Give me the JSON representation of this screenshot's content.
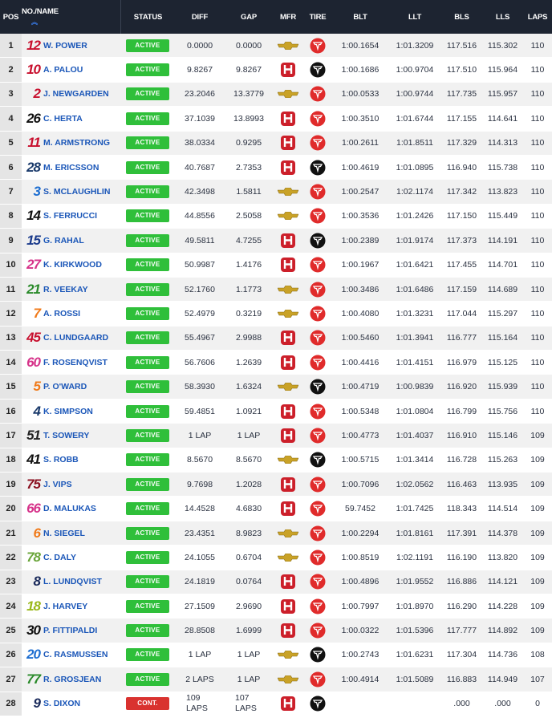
{
  "headers": {
    "pos": "POS",
    "name": "NO./NAME",
    "status": "STATUS",
    "diff": "DIFF",
    "gap": "GAP",
    "mfr": "MFR",
    "tire": "TIRE",
    "blt": "BLT",
    "llt": "LLT",
    "bls": "BLS",
    "lls": "LLS",
    "laps": "LAPS"
  },
  "colors": {
    "header_bg": "#1d2431",
    "active": "#2fbf3a",
    "cont": "#d9322f",
    "name": "#1a56b8",
    "tire_red": "#e02b2b",
    "tire_black": "#111111",
    "honda_red": "#cc1f2a",
    "chevy_gold": "#c9a227"
  },
  "rows": [
    {
      "pos": "1",
      "num": "12",
      "num_color": "#c8102e",
      "name": "W. POWER",
      "status": "ACTIVE",
      "diff": "0.0000",
      "gap": "0.0000",
      "mfr": "chevrolet",
      "tire": "red",
      "blt": "1:00.1654",
      "llt": "1:01.3209",
      "bls": "117.516",
      "lls": "115.302",
      "laps": "110"
    },
    {
      "pos": "2",
      "num": "10",
      "num_color": "#c8102e",
      "name": "A. PALOU",
      "status": "ACTIVE",
      "diff": "9.8267",
      "gap": "9.8267",
      "mfr": "honda",
      "tire": "black",
      "blt": "1:00.1686",
      "llt": "1:00.9704",
      "bls": "117.510",
      "lls": "115.964",
      "laps": "110"
    },
    {
      "pos": "3",
      "num": "2",
      "num_color": "#c8102e",
      "name": "J. NEWGARDEN",
      "status": "ACTIVE",
      "diff": "23.2046",
      "gap": "13.3779",
      "mfr": "chevrolet",
      "tire": "red",
      "blt": "1:00.0533",
      "llt": "1:00.9744",
      "bls": "117.735",
      "lls": "115.957",
      "laps": "110"
    },
    {
      "pos": "4",
      "num": "26",
      "num_color": "#111111",
      "name": "C. HERTA",
      "status": "ACTIVE",
      "diff": "37.1039",
      "gap": "13.8993",
      "mfr": "honda",
      "tire": "red",
      "blt": "1:00.3510",
      "llt": "1:01.6744",
      "bls": "117.155",
      "lls": "114.641",
      "laps": "110"
    },
    {
      "pos": "5",
      "num": "11",
      "num_color": "#c8102e",
      "name": "M. ARMSTRONG",
      "status": "ACTIVE",
      "diff": "38.0334",
      "gap": "0.9295",
      "mfr": "honda",
      "tire": "red",
      "blt": "1:00.2611",
      "llt": "1:01.8511",
      "bls": "117.329",
      "lls": "114.313",
      "laps": "110"
    },
    {
      "pos": "6",
      "num": "28",
      "num_color": "#1a3a6b",
      "name": "M. ERICSSON",
      "status": "ACTIVE",
      "diff": "40.7687",
      "gap": "2.7353",
      "mfr": "honda",
      "tire": "black",
      "blt": "1:00.4619",
      "llt": "1:01.0895",
      "bls": "116.940",
      "lls": "115.738",
      "laps": "110"
    },
    {
      "pos": "7",
      "num": "3",
      "num_color": "#1f6fd1",
      "name": "S. MCLAUGHLIN",
      "status": "ACTIVE",
      "diff": "42.3498",
      "gap": "1.5811",
      "mfr": "chevrolet",
      "tire": "red",
      "blt": "1:00.2547",
      "llt": "1:02.1174",
      "bls": "117.342",
      "lls": "113.823",
      "laps": "110"
    },
    {
      "pos": "8",
      "num": "14",
      "num_color": "#111111",
      "name": "S. FERRUCCI",
      "status": "ACTIVE",
      "diff": "44.8556",
      "gap": "2.5058",
      "mfr": "chevrolet",
      "tire": "red",
      "blt": "1:00.3536",
      "llt": "1:01.2426",
      "bls": "117.150",
      "lls": "115.449",
      "laps": "110"
    },
    {
      "pos": "9",
      "num": "15",
      "num_color": "#1a3a8b",
      "name": "G. RAHAL",
      "status": "ACTIVE",
      "diff": "49.5811",
      "gap": "4.7255",
      "mfr": "honda",
      "tire": "black",
      "blt": "1:00.2389",
      "llt": "1:01.9174",
      "bls": "117.373",
      "lls": "114.191",
      "laps": "110"
    },
    {
      "pos": "10",
      "num": "27",
      "num_color": "#d6338a",
      "name": "K. KIRKWOOD",
      "status": "ACTIVE",
      "diff": "50.9987",
      "gap": "1.4176",
      "mfr": "honda",
      "tire": "red",
      "blt": "1:00.1967",
      "llt": "1:01.6421",
      "bls": "117.455",
      "lls": "114.701",
      "laps": "110"
    },
    {
      "pos": "11",
      "num": "21",
      "num_color": "#2a8a2a",
      "name": "R. VEEKAY",
      "status": "ACTIVE",
      "diff": "52.1760",
      "gap": "1.1773",
      "mfr": "chevrolet",
      "tire": "red",
      "blt": "1:00.3486",
      "llt": "1:01.6486",
      "bls": "117.159",
      "lls": "114.689",
      "laps": "110"
    },
    {
      "pos": "12",
      "num": "7",
      "num_color": "#f07a1a",
      "name": "A. ROSSI",
      "status": "ACTIVE",
      "diff": "52.4979",
      "gap": "0.3219",
      "mfr": "chevrolet",
      "tire": "red",
      "blt": "1:00.4080",
      "llt": "1:01.3231",
      "bls": "117.044",
      "lls": "115.297",
      "laps": "110"
    },
    {
      "pos": "13",
      "num": "45",
      "num_color": "#c8102e",
      "name": "C. LUNDGAARD",
      "status": "ACTIVE",
      "diff": "55.4967",
      "gap": "2.9988",
      "mfr": "honda",
      "tire": "red",
      "blt": "1:00.5460",
      "llt": "1:01.3941",
      "bls": "116.777",
      "lls": "115.164",
      "laps": "110"
    },
    {
      "pos": "14",
      "num": "60",
      "num_color": "#d6338a",
      "name": "F. ROSENQVIST",
      "status": "ACTIVE",
      "diff": "56.7606",
      "gap": "1.2639",
      "mfr": "honda",
      "tire": "red",
      "blt": "1:00.4416",
      "llt": "1:01.4151",
      "bls": "116.979",
      "lls": "115.125",
      "laps": "110"
    },
    {
      "pos": "15",
      "num": "5",
      "num_color": "#f07a1a",
      "name": "P. O'WARD",
      "status": "ACTIVE",
      "diff": "58.3930",
      "gap": "1.6324",
      "mfr": "chevrolet",
      "tire": "black",
      "blt": "1:00.4719",
      "llt": "1:00.9839",
      "bls": "116.920",
      "lls": "115.939",
      "laps": "110"
    },
    {
      "pos": "16",
      "num": "4",
      "num_color": "#1a3a6b",
      "name": "K. SIMPSON",
      "status": "ACTIVE",
      "diff": "59.4851",
      "gap": "1.0921",
      "mfr": "honda",
      "tire": "red",
      "blt": "1:00.5348",
      "llt": "1:01.0804",
      "bls": "116.799",
      "lls": "115.756",
      "laps": "110"
    },
    {
      "pos": "17",
      "num": "51",
      "num_color": "#222222",
      "name": "T. SOWERY",
      "status": "ACTIVE",
      "diff": "1 LAP",
      "gap": "1 LAP",
      "mfr": "honda",
      "tire": "red",
      "blt": "1:00.4773",
      "llt": "1:01.4037",
      "bls": "116.910",
      "lls": "115.146",
      "laps": "109"
    },
    {
      "pos": "18",
      "num": "41",
      "num_color": "#111111",
      "name": "S. ROBB",
      "status": "ACTIVE",
      "diff": "8.5670",
      "gap": "8.5670",
      "mfr": "chevrolet",
      "tire": "black",
      "blt": "1:00.5715",
      "llt": "1:01.3414",
      "bls": "116.728",
      "lls": "115.263",
      "laps": "109"
    },
    {
      "pos": "19",
      "num": "75",
      "num_color": "#8a1020",
      "name": "J. VIPS",
      "status": "ACTIVE",
      "diff": "9.7698",
      "gap": "1.2028",
      "mfr": "honda",
      "tire": "red",
      "blt": "1:00.7096",
      "llt": "1:02.0562",
      "bls": "116.463",
      "lls": "113.935",
      "laps": "109"
    },
    {
      "pos": "20",
      "num": "66",
      "num_color": "#d6338a",
      "name": "D. MALUKAS",
      "status": "ACTIVE",
      "diff": "14.4528",
      "gap": "4.6830",
      "mfr": "honda",
      "tire": "red",
      "blt": "59.7452",
      "llt": "1:01.7425",
      "bls": "118.343",
      "lls": "114.514",
      "laps": "109"
    },
    {
      "pos": "21",
      "num": "6",
      "num_color": "#f07a1a",
      "name": "N. SIEGEL",
      "status": "ACTIVE",
      "diff": "23.4351",
      "gap": "8.9823",
      "mfr": "chevrolet",
      "tire": "red",
      "blt": "1:00.2294",
      "llt": "1:01.8161",
      "bls": "117.391",
      "lls": "114.378",
      "laps": "109"
    },
    {
      "pos": "22",
      "num": "78",
      "num_color": "#6aa53a",
      "name": "C. DALY",
      "status": "ACTIVE",
      "diff": "24.1055",
      "gap": "0.6704",
      "mfr": "chevrolet",
      "tire": "red",
      "blt": "1:00.8519",
      "llt": "1:02.1191",
      "bls": "116.190",
      "lls": "113.820",
      "laps": "109"
    },
    {
      "pos": "23",
      "num": "8",
      "num_color": "#1a2a5b",
      "name": "L. LUNDQVIST",
      "status": "ACTIVE",
      "diff": "24.1819",
      "gap": "0.0764",
      "mfr": "honda",
      "tire": "red",
      "blt": "1:00.4896",
      "llt": "1:01.9552",
      "bls": "116.886",
      "lls": "114.121",
      "laps": "109"
    },
    {
      "pos": "24",
      "num": "18",
      "num_color": "#9ab81a",
      "name": "J. HARVEY",
      "status": "ACTIVE",
      "diff": "27.1509",
      "gap": "2.9690",
      "mfr": "honda",
      "tire": "red",
      "blt": "1:00.7997",
      "llt": "1:01.8970",
      "bls": "116.290",
      "lls": "114.228",
      "laps": "109"
    },
    {
      "pos": "25",
      "num": "30",
      "num_color": "#111111",
      "name": "P. FITTIPALDI",
      "status": "ACTIVE",
      "diff": "28.8508",
      "gap": "1.6999",
      "mfr": "honda",
      "tire": "red",
      "blt": "1:00.0322",
      "llt": "1:01.5396",
      "bls": "117.777",
      "lls": "114.892",
      "laps": "109"
    },
    {
      "pos": "26",
      "num": "20",
      "num_color": "#1f6fd1",
      "name": "C. RASMUSSEN",
      "status": "ACTIVE",
      "diff": "1 LAP",
      "gap": "1 LAP",
      "mfr": "chevrolet",
      "tire": "black",
      "blt": "1:00.2743",
      "llt": "1:01.6231",
      "bls": "117.304",
      "lls": "114.736",
      "laps": "108"
    },
    {
      "pos": "27",
      "num": "77",
      "num_color": "#2a8a2a",
      "name": "R. GROSJEAN",
      "status": "ACTIVE",
      "diff": "2 LAPS",
      "gap": "1 LAP",
      "mfr": "chevrolet",
      "tire": "red",
      "blt": "1:00.4914",
      "llt": "1:01.5089",
      "bls": "116.883",
      "lls": "114.949",
      "laps": "107"
    },
    {
      "pos": "28",
      "num": "9",
      "num_color": "#1a2a5b",
      "name": "S. DIXON",
      "status": "CONT.",
      "diff": "109 LAPS",
      "gap": "107 LAPS",
      "mfr": "honda",
      "tire": "black",
      "blt": "",
      "llt": "",
      "bls": ".000",
      "lls": ".000",
      "laps": "0"
    }
  ]
}
